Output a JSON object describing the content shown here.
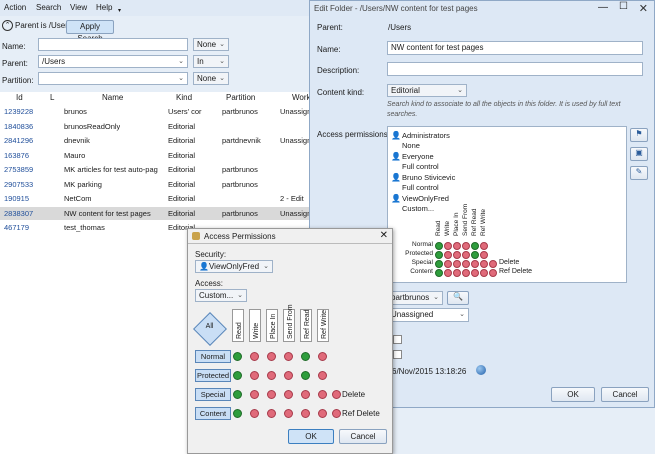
{
  "menu": {
    "items": [
      "Action",
      "Search",
      "View",
      "Help"
    ]
  },
  "parent_bar": {
    "label": "Parent is /Users",
    "apply_search": "Apply Search"
  },
  "filters": {
    "name_label": "Name:",
    "name_value": "",
    "name_op": "None",
    "parent_label": "Parent:",
    "parent_value": "/Users",
    "parent_op": "In",
    "partition_label": "Partition:",
    "partition_value": "",
    "partition_op": "None"
  },
  "grid": {
    "headers": [
      "Id",
      "L",
      "Name",
      "Kind",
      "Partition",
      "Works"
    ],
    "rows": [
      {
        "id": "1239228",
        "name": "brunos",
        "kind": "Users' cor",
        "partition": "partbrunos",
        "works": "Unassigne"
      },
      {
        "id": "1840836",
        "name": "brunosReadOnly",
        "kind": "Editorial",
        "partition": "",
        "works": ""
      },
      {
        "id": "2841296",
        "name": "dnevnik",
        "kind": "Editorial",
        "partition": "partdnevnik",
        "works": "Unassigne"
      },
      {
        "id": "163876",
        "name": "Mauro",
        "kind": "Editorial",
        "partition": "",
        "works": ""
      },
      {
        "id": "2753859",
        "name": "MK articles for test auto-pag",
        "kind": "Editorial",
        "partition": "partbrunos",
        "works": ""
      },
      {
        "id": "2907533",
        "name": "MK parking",
        "kind": "Editorial",
        "partition": "partbrunos",
        "works": ""
      },
      {
        "id": "190915",
        "name": "NetCom",
        "kind": "Editorial",
        "partition": "",
        "works": "2 - Edit"
      },
      {
        "id": "2838307",
        "name": "NW content for test pages",
        "kind": "Editorial",
        "partition": "partbrunos",
        "works": "Unassigne"
      },
      {
        "id": "467179",
        "name": "test_thomas",
        "kind": "Editorial",
        "partition": "",
        "works": ""
      }
    ]
  },
  "edit_folder": {
    "title": "Edit Folder - /Users/NW content for test pages",
    "parent_label": "Parent:",
    "parent_value": "/Users",
    "name_label": "Name:",
    "name_value": "NW content for test pages",
    "description_label": "Description:",
    "description_value": "",
    "content_kind_label": "Content kind:",
    "content_kind_value": "Editorial",
    "content_kind_hint": "Search kind to associate to all the objects in this folder. It is used by full text searches.",
    "access_label": "Access permissions:",
    "permissions": [
      {
        "name": "Administrators",
        "level": "None"
      },
      {
        "name": "Everyone",
        "level": "Full control"
      },
      {
        "name": "Bruno Stivicevic",
        "level": "Full control"
      },
      {
        "name": "ViewOnlyFred",
        "level": "Custom..."
      }
    ],
    "mini_cols": [
      "Read",
      "Write",
      "Place In",
      "Send From",
      "Ref Read",
      "Ref Write"
    ],
    "mini_rows": [
      "Normal",
      "Protected",
      "Special",
      "Content"
    ],
    "mini_extra": {
      "Special": "Delete",
      "Content": "Ref Delete"
    },
    "partition_value": "partbrunos",
    "workflow_value": "Unassigned",
    "timestamp": "6/Nov/2015 13:18:26",
    "ok": "OK",
    "cancel": "Cancel"
  },
  "access_dialog": {
    "title": "Access Permissions",
    "security_label": "Security:",
    "security_value": "ViewOnlyFred",
    "access_label": "Access:",
    "access_value": "Custom...",
    "all_button": "All",
    "columns": [
      "Read",
      "Write",
      "Place In",
      "Send From",
      "Ref Read",
      "Ref Write"
    ],
    "rows": [
      {
        "label": "Normal",
        "cells": [
          1,
          0,
          0,
          0,
          1,
          0
        ],
        "extra": ""
      },
      {
        "label": "Protected",
        "cells": [
          1,
          0,
          0,
          0,
          1,
          0
        ],
        "extra": ""
      },
      {
        "label": "Special",
        "cells": [
          1,
          0,
          0,
          0,
          0,
          0
        ],
        "extra_cell": 0,
        "extra": "Delete"
      },
      {
        "label": "Content",
        "cells": [
          1,
          0,
          0,
          0,
          0,
          0
        ],
        "extra_cell": 0,
        "extra": "Ref Delete"
      }
    ],
    "ok": "OK",
    "cancel": "Cancel"
  },
  "colors": {
    "green": "#2e9d3c",
    "red": "#e06a7a",
    "selected_row": "#d9d9d9"
  }
}
